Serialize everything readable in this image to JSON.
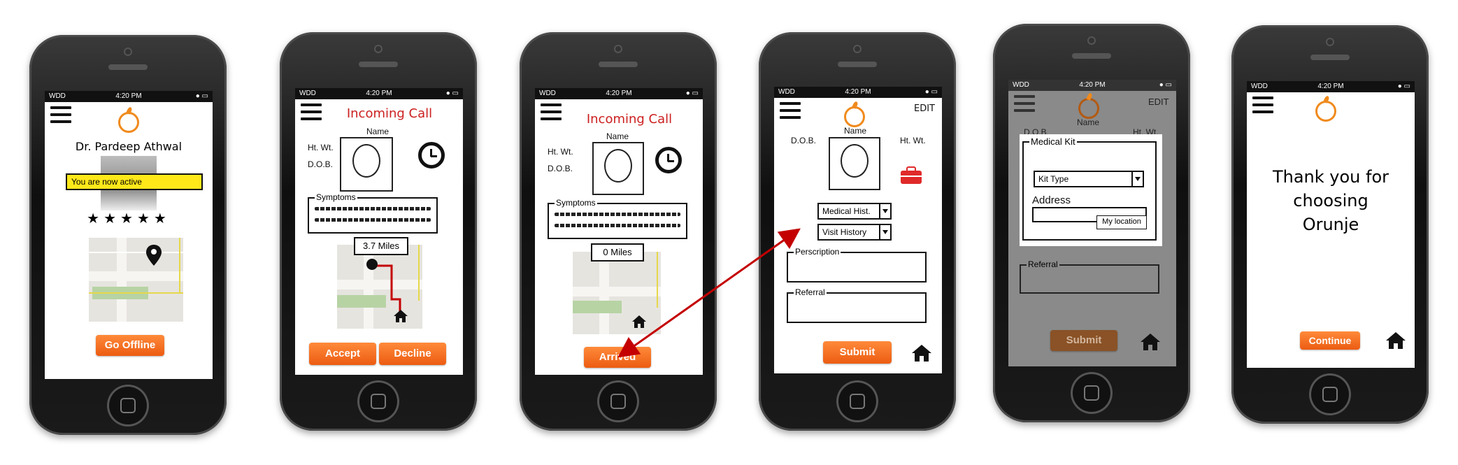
{
  "status_bar": {
    "carrier": "WDD",
    "time": "4:20 PM"
  },
  "screen1": {
    "doctor_name": "Dr. Pardeep Athwal",
    "active_banner": "You are now active",
    "stars": "★★★★★",
    "button": "Go Offline"
  },
  "screen2": {
    "title": "Incoming Call",
    "name_label": "Name",
    "ht_wt": "Ht. Wt.",
    "dob": "D.O.B.",
    "symptoms_label": "Symptoms",
    "distance": "3.7 Miles",
    "accept": "Accept",
    "decline": "Decline"
  },
  "screen3": {
    "title": "Incoming Call",
    "name_label": "Name",
    "ht_wt": "Ht. Wt.",
    "dob": "D.O.B.",
    "symptoms_label": "Symptoms",
    "distance": "0 Miles",
    "button": "Arrived"
  },
  "screen4": {
    "edit": "EDIT",
    "dob": "D.O.B.",
    "name_label": "Name",
    "ht_wt": "Ht. Wt.",
    "medical_history": "Medical Hist.",
    "visit_history": "Visit History",
    "prescription_label": "Perscription",
    "referral_label": "Referral",
    "submit": "Submit"
  },
  "screen5": {
    "edit": "EDIT",
    "dob": "D.O.B.",
    "name_label": "Name",
    "ht_wt": "Ht. Wt.",
    "medical_kit_label": "Medical Kit",
    "kit_type": "Kit Type",
    "address_label": "Address",
    "my_location": "My location",
    "referral_label": "Referral",
    "submit": "Submit"
  },
  "screen6": {
    "message": "Thank you for choosing Orunje",
    "continue": "Continue"
  },
  "colors": {
    "accent": "#f0711e",
    "title_red": "#cc1f1f",
    "arrow": "#c40000",
    "banner": "#ffe81a"
  }
}
